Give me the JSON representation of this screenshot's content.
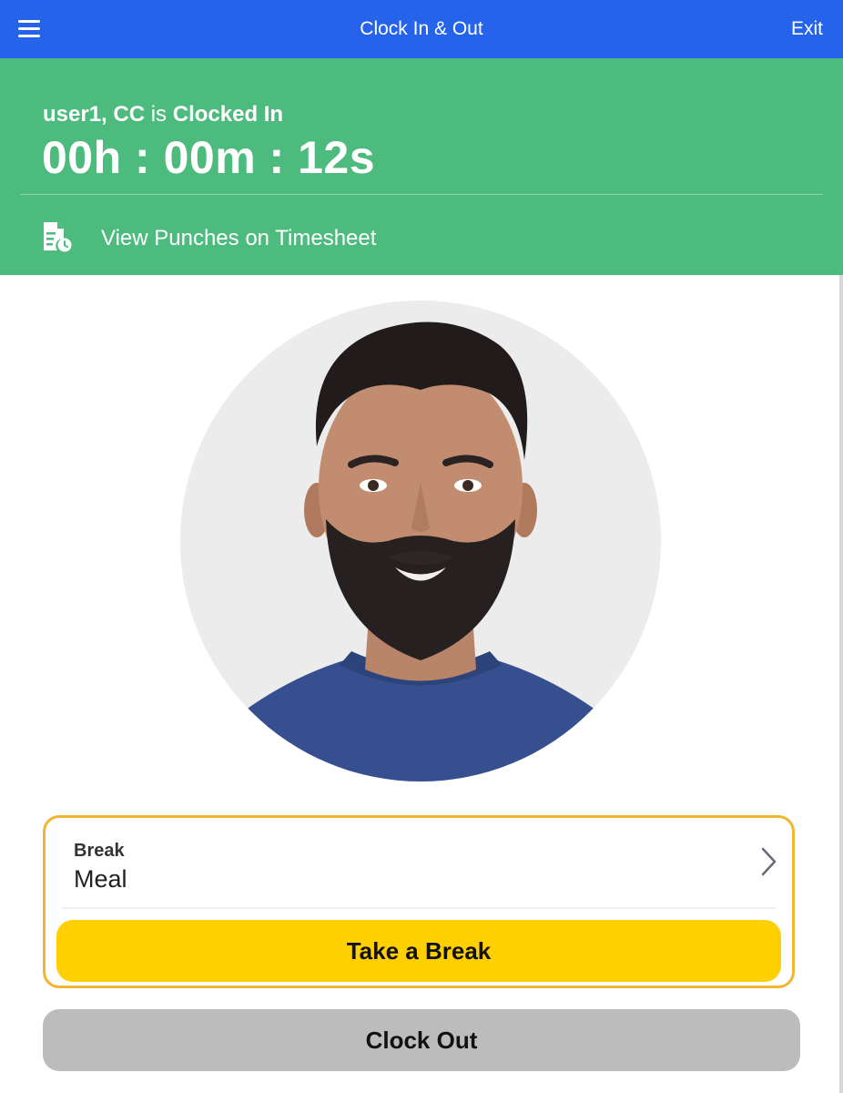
{
  "header": {
    "title": "Clock In & Out",
    "exit_label": "Exit",
    "menu_icon": "hamburger-menu-icon"
  },
  "status": {
    "user_name": "user1, CC",
    "connector": "is",
    "state": "Clocked In",
    "timer": "00h : 00m : 12s",
    "timesheet_link": "View Punches on Timesheet",
    "timesheet_icon": "timesheet-document-clock-icon"
  },
  "colors": {
    "header_bg": "#2563eb",
    "status_bg": "#4dbb7e",
    "break_border": "#f2b531",
    "take_break_bg": "#fecf01",
    "clock_out_bg": "#bcbcbc"
  },
  "break_section": {
    "label": "Break",
    "selected_type": "Meal",
    "take_break_label": "Take a Break"
  },
  "clock_out_label": "Clock Out"
}
